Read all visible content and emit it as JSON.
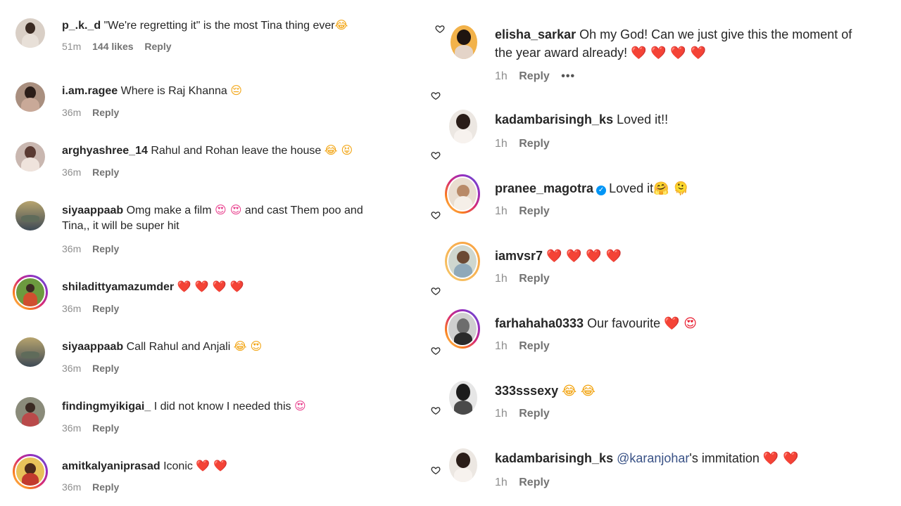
{
  "left": [
    {
      "user": "p_.k._d",
      "text": "\"We're regretting it\" is the most Tina thing ever",
      "emoji": "😂",
      "time": "51m",
      "likes": "144 likes",
      "reply": "Reply"
    },
    {
      "user": "i.am.ragee",
      "text": "Where is Raj Khanna",
      "emoji": "😔",
      "time": "36m",
      "reply": "Reply"
    },
    {
      "user": "arghyashree_14",
      "text": "Rahul and Rohan leave the house",
      "emoji": "😂 😝",
      "time": "36m",
      "reply": "Reply"
    },
    {
      "user": "siyaappaab",
      "text": "Omg make a film",
      "emoji": "😍 😍",
      "text2": "and cast Them poo and",
      "line2": "Tina,, it will be super hit",
      "time": "36m",
      "reply": "Reply"
    },
    {
      "user": "shiladittyamazumder",
      "text": "",
      "emoji": "❤️ ❤️ ❤️ ❤️",
      "time": "36m",
      "reply": "Reply"
    },
    {
      "user": "siyaappaab",
      "text": "Call Rahul and Anjali",
      "emoji": "😂 😍",
      "time": "36m",
      "reply": "Reply"
    },
    {
      "user": "findingmyikigai_",
      "text": "I did not know I needed this",
      "emoji": "😍",
      "time": "36m",
      "reply": "Reply"
    },
    {
      "user": "amitkalyaniprasad",
      "text": "Iconic",
      "emoji": "❤️ ❤️",
      "time": "36m",
      "reply": "Reply"
    }
  ],
  "right": [
    {
      "user": "elisha_sarkar",
      "text": "Oh my God! Can we just give this the moment of",
      "line2": "the year award already!",
      "emoji": "❤️ ❤️ ❤️ ❤️",
      "time": "1h",
      "reply": "Reply",
      "more": "•••"
    },
    {
      "user": "kadambarisingh_ks",
      "text": "Loved it!!",
      "time": "1h",
      "reply": "Reply"
    },
    {
      "user": "pranee_magotra",
      "verified": "✓",
      "text": "Loved it",
      "emoji": "🤗 🫠",
      "time": "1h",
      "reply": "Reply"
    },
    {
      "user": "iamvsr7",
      "text": "",
      "emoji": "❤️ ❤️ ❤️ ❤️",
      "time": "1h",
      "reply": "Reply"
    },
    {
      "user": "farhahaha0333",
      "text": "Our favourite",
      "emoji": "❤️ 😍",
      "time": "1h",
      "reply": "Reply"
    },
    {
      "user": "333sssexy",
      "text": "",
      "emoji": "😂 😂",
      "time": "1h",
      "reply": "Reply"
    },
    {
      "user": "kadambarisingh_ks",
      "mention": "@karanjohar",
      "text": "'s immitation",
      "emoji": "❤️ ❤️",
      "time": "1h",
      "reply": "Reply"
    }
  ],
  "icons": {
    "like": "heart-outline-icon",
    "verified": "verified-badge-icon"
  }
}
